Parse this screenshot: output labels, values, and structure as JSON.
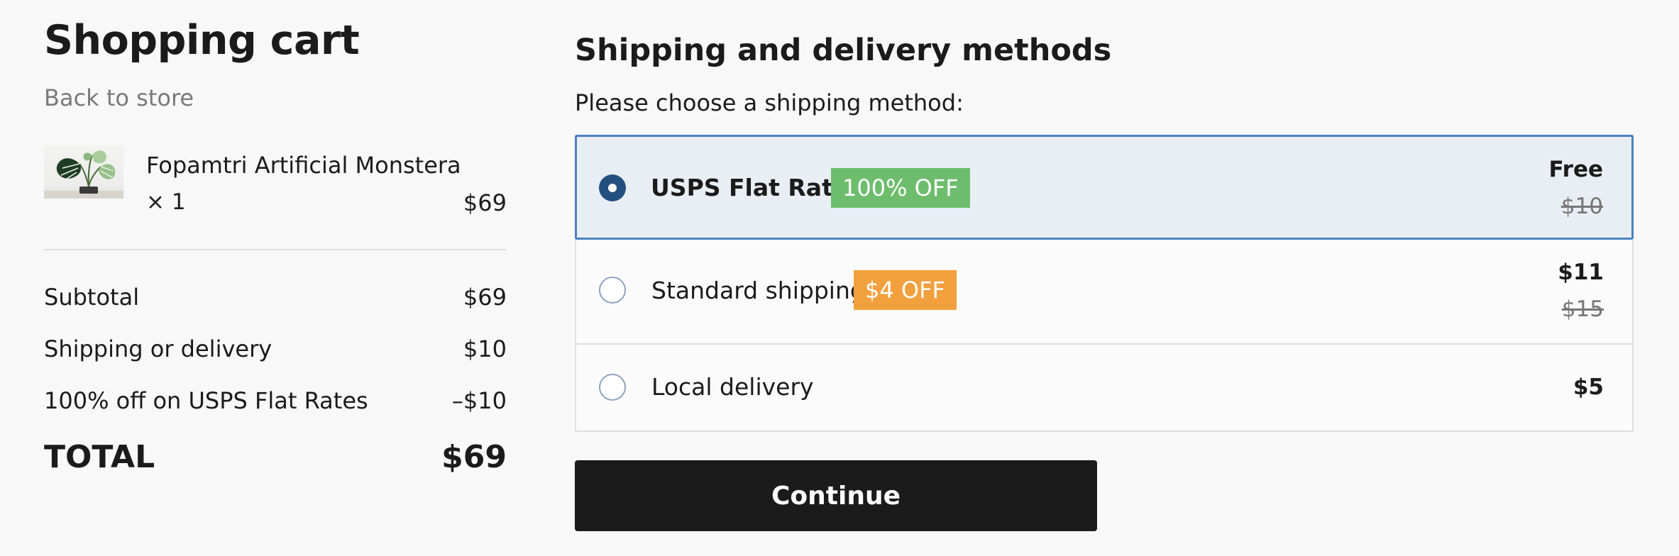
{
  "cart": {
    "title": "Shopping cart",
    "back_link": "Back to store",
    "item": {
      "name": "Fopamtri Artificial Monstera",
      "quantity": "× 1",
      "price": "$69",
      "image_icon": "monstera-plant-thumbnail"
    },
    "summary": [
      {
        "label": "Subtotal",
        "value": "$69"
      },
      {
        "label": "Shipping or delivery",
        "value": "$10"
      },
      {
        "label": "100% off on USPS Flat Rates",
        "value": "–$10"
      }
    ],
    "total": {
      "label": "TOTAL",
      "value": "$69"
    }
  },
  "shipping": {
    "title": "Shipping and delivery methods",
    "subtitle": "Please choose a shipping method:",
    "options": [
      {
        "name": "USPS Flat Rates",
        "badge": "100% OFF",
        "badge_color": "#6dbd6d",
        "price": "Free",
        "original_price": "$10",
        "selected": true
      },
      {
        "name": "Standard shipping",
        "badge": "$4 OFF",
        "badge_color": "#f2a03d",
        "price": "$11",
        "original_price": "$15",
        "selected": false
      },
      {
        "name": "Local delivery",
        "badge": "",
        "price": "$5",
        "original_price": "",
        "selected": false
      }
    ],
    "continue_label": "Continue"
  },
  "colors": {
    "selected_border": "#4b81c1",
    "selected_bg": "#e9eef4",
    "radio_checked": "#23507f",
    "button_bg": "#1b1b1b"
  }
}
